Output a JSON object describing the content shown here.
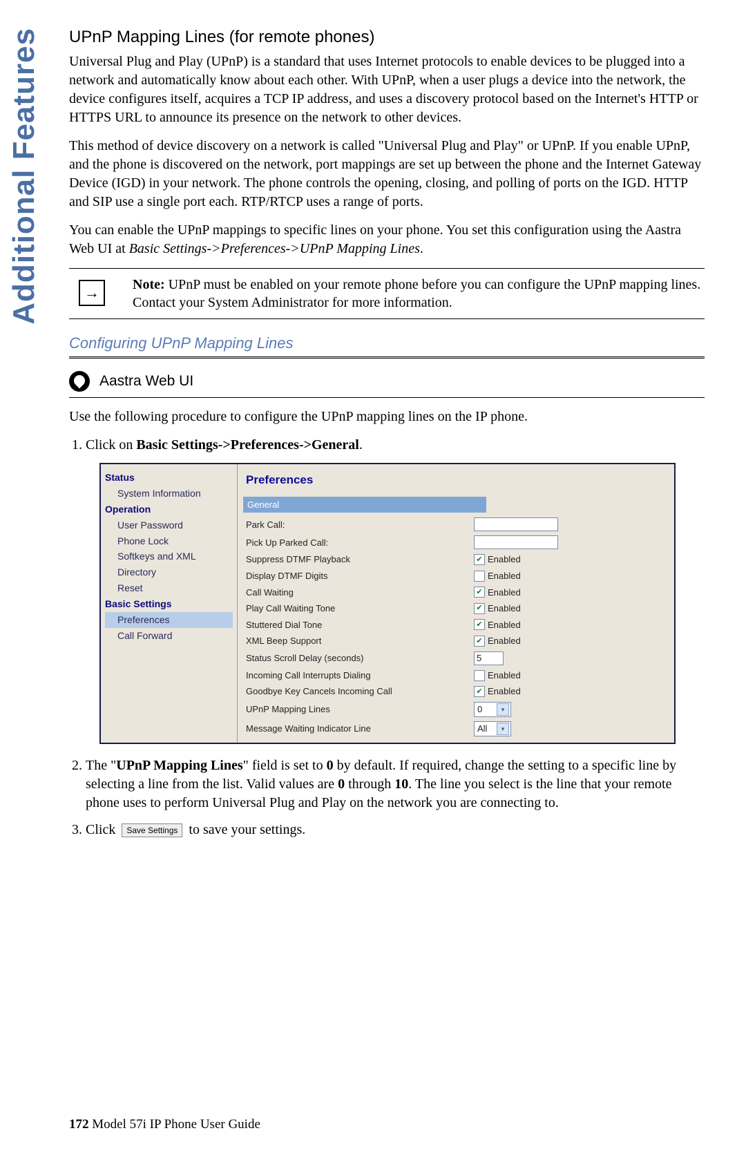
{
  "sideTab": "Additional Features",
  "heading1": "UPnP Mapping Lines (for remote phones)",
  "para1": "Universal Plug and Play (UPnP) is a standard that uses Internet protocols to enable devices to be plugged into a network and automatically know about each other. With UPnP, when a user plugs a device into the network, the device configures itself, acquires a TCP IP address, and uses a discovery protocol based on the Internet's HTTP or HTTPS URL to announce its presence on the network to other devices.",
  "para2": "This method of device discovery on a network is called \"Universal Plug and Play\" or UPnP. If you enable UPnP, and the phone is discovered on the network, port mappings are set up between the phone and the Internet Gateway Device (IGD) in your network. The phone controls the opening, closing, and polling of ports on the IGD. HTTP and SIP use a single port each. RTP/RTCP uses a range of ports.",
  "para3a": "You can enable the UPnP mappings to specific lines on your phone. You set this configuration using the Aastra Web UI at ",
  "para3b": "Basic Settings->Preferences->UPnP Mapping Lines",
  "para3c": ".",
  "note": {
    "label": "Note:",
    "text": " UPnP must be enabled on your remote phone before you can configure the UPnP mapping lines. Contact your System Administrator for more information.",
    "arrow": "→"
  },
  "heading2": "Configuring UPnP Mapping Lines",
  "webui": "Aastra Web UI",
  "para4": "Use the following procedure to configure the UPnP mapping lines on the IP phone.",
  "step1a": "Click on ",
  "step1b": "Basic Settings->Preferences->General",
  "step1c": ".",
  "step2a": "The \"",
  "step2b": "UPnP Mapping Lines",
  "step2c": "\" field is set to ",
  "step2d": "0",
  "step2e": " by default. If required, change the setting to a specific line by selecting a line from the list. Valid values are ",
  "step2f": "0",
  "step2g": " through ",
  "step2h": "10",
  "step2i": ". The line you select is the line that your remote phone uses to perform Universal Plug and Play on the network you are connecting to.",
  "step3a": "Click ",
  "step3b": "Save Settings",
  "step3c": " to save your settings.",
  "screenshot": {
    "sidebar": {
      "g1": "Status",
      "g1i1": "System Information",
      "g2": "Operation",
      "g2i1": "User Password",
      "g2i2": "Phone Lock",
      "g2i3": "Softkeys and XML",
      "g2i4": "Directory",
      "g2i5": "Reset",
      "g3": "Basic Settings",
      "g3i1": "Preferences",
      "g3i2": "Call Forward"
    },
    "main": {
      "title": "Preferences",
      "section": "General",
      "rows": {
        "r1": "Park Call:",
        "r2": "Pick Up Parked Call:",
        "r3": "Suppress DTMF Playback",
        "r4": "Display DTMF Digits",
        "r5": "Call Waiting",
        "r6": "Play Call Waiting Tone",
        "r7": "Stuttered Dial Tone",
        "r8": "XML Beep Support",
        "r9": "Status Scroll Delay (seconds)",
        "r10": "Incoming Call Interrupts Dialing",
        "r11": "Goodbye Key Cancels Incoming Call",
        "r12": "UPnP Mapping Lines",
        "r13": "Message Waiting Indicator Line"
      },
      "enabled": "Enabled",
      "checks": {
        "r3": true,
        "r4": false,
        "r5": true,
        "r6": true,
        "r7": true,
        "r8": true,
        "r10": false,
        "r11": true
      },
      "scrollDelay": "5",
      "upnpValue": "0",
      "mwiValue": "All"
    }
  },
  "footer": {
    "page": "172",
    "title": " Model 57i IP Phone User Guide"
  }
}
